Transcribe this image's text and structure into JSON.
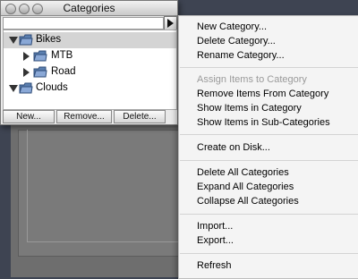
{
  "window": {
    "title": "Categories",
    "tree": [
      {
        "label": "Bikes",
        "expanded": true,
        "selected": true
      },
      {
        "label": "MTB",
        "expanded": false,
        "selected": false
      },
      {
        "label": "Road",
        "expanded": false,
        "selected": false
      },
      {
        "label": "Clouds",
        "expanded": true,
        "selected": false
      }
    ],
    "buttons": {
      "new": "New...",
      "remove": "Remove...",
      "delete": "Delete..."
    }
  },
  "menu": {
    "items": [
      {
        "label": "New Category...",
        "enabled": true
      },
      {
        "label": "Delete Category...",
        "enabled": true
      },
      {
        "label": "Rename Category...",
        "enabled": true
      },
      {
        "label": "Assign Items to Category",
        "enabled": false
      },
      {
        "label": "Remove Items From Category",
        "enabled": true
      },
      {
        "label": "Show Items in Category",
        "enabled": true
      },
      {
        "label": "Show Items in Sub-Categories",
        "enabled": true
      },
      {
        "label": "Create on Disk...",
        "enabled": true
      },
      {
        "label": "Delete All Categories",
        "enabled": true
      },
      {
        "label": "Expand All Categories",
        "enabled": true
      },
      {
        "label": "Collapse All Categories",
        "enabled": true
      },
      {
        "label": "Import...",
        "enabled": true
      },
      {
        "label": "Export...",
        "enabled": true
      },
      {
        "label": "Refresh",
        "enabled": true
      }
    ]
  },
  "colors": {
    "selected_row": "#d4d4d4",
    "disabled_text": "#9a9a9a",
    "folder_blue": "#4a6a9a"
  }
}
